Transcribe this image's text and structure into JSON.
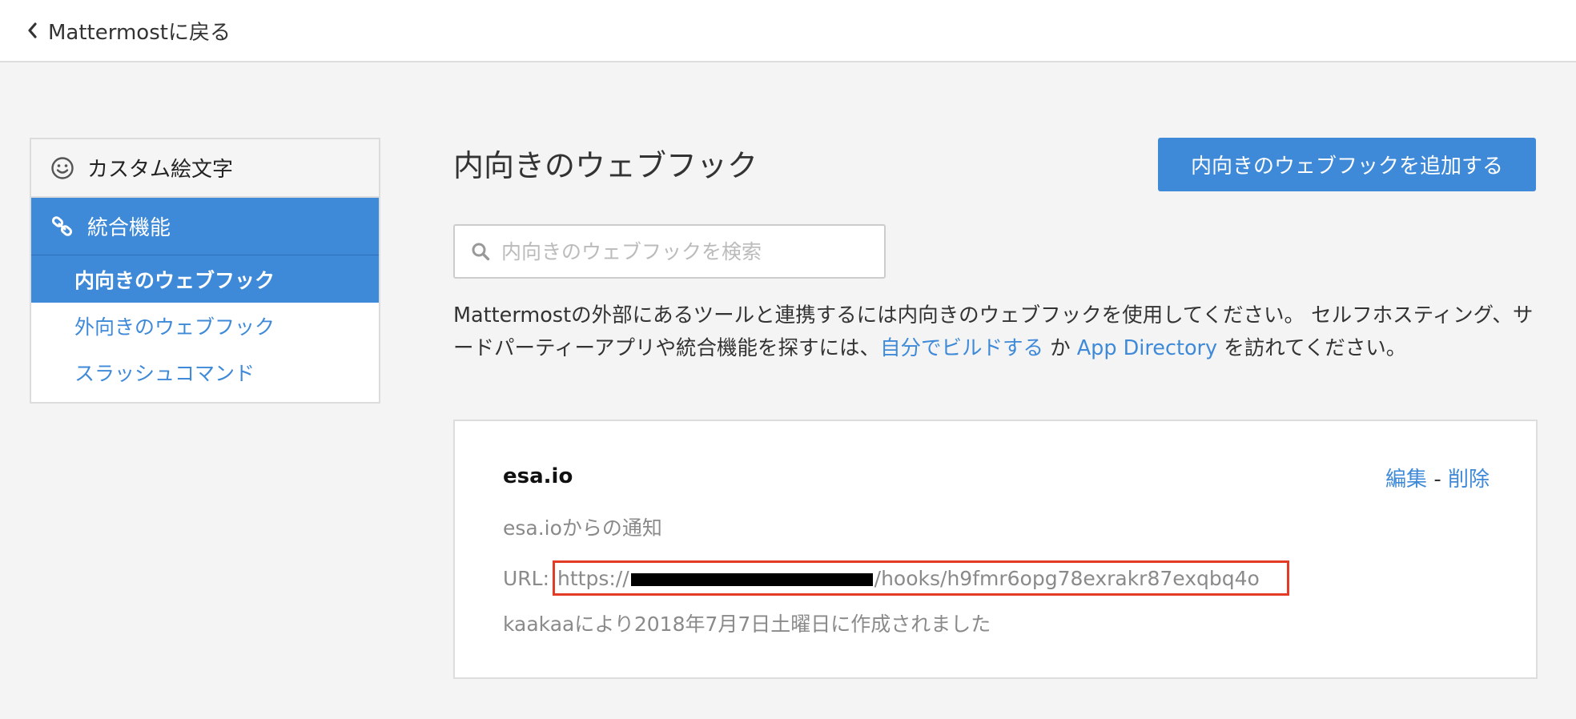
{
  "header": {
    "back_label": "Mattermostに戻る"
  },
  "sidebar": {
    "custom_emoji_label": "カスタム絵文字",
    "integrations_label": "統合機能",
    "items": [
      {
        "label": "内向きのウェブフック",
        "active": true
      },
      {
        "label": "外向きのウェブフック",
        "active": false
      },
      {
        "label": "スラッシュコマンド",
        "active": false
      }
    ]
  },
  "main": {
    "title": "内向きのウェブフック",
    "add_button_label": "内向きのウェブフックを追加する",
    "search_placeholder": "内向きのウェブフックを検索",
    "help": {
      "text_1": "Mattermostの外部にあるツールと連携するには内向きのウェブフックを使用してください。 セルフホスティング、サードパーティーアプリや統合機能を探すには、",
      "build_link": "自分でビルドする",
      "text_2": " か ",
      "directory_link": "App Directory",
      "text_3": " を訪れてください。"
    },
    "hook": {
      "name": "esa.io",
      "edit_label": "編集",
      "separator": " - ",
      "delete_label": "削除",
      "description": "esa.ioからの通知",
      "url_label": "URL: ",
      "url_prefix": "https://",
      "url_suffix": "/hooks/h9fmr6opg78exrakr87exqbq4o",
      "created": "kaakaaにより2018年7月7日土曜日に作成されました"
    }
  },
  "colors": {
    "accent": "#3f8ad8",
    "highlight_border": "#e23c26",
    "background": "#f4f4f4"
  }
}
